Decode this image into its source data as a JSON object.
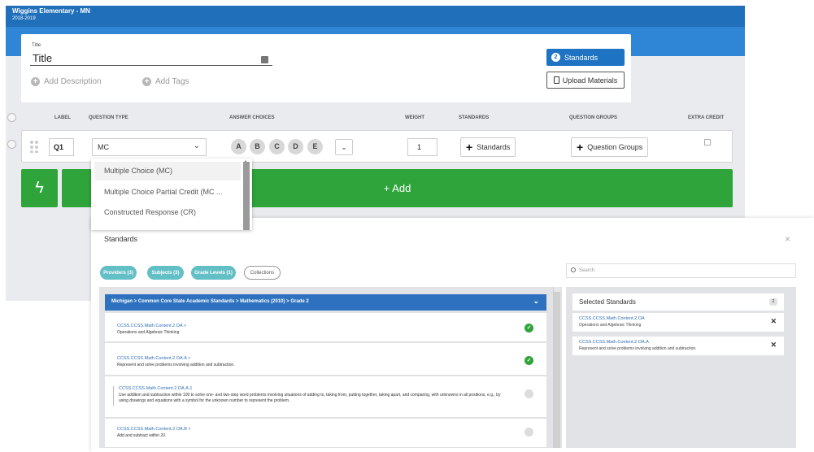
{
  "header": {
    "school": "Wiggins Elementary - MN",
    "year": "2018-2019"
  },
  "form": {
    "title_label": "Title",
    "title_value": "Title",
    "add_description": "Add Description",
    "add_tags": "Add Tags",
    "standards_count": "2",
    "standards_button": "Standards",
    "upload_button": "Upload Materials"
  },
  "columns": {
    "label": "LABEL",
    "question_type": "QUESTION TYPE",
    "answer_choices": "ANSWER CHOICES",
    "weight": "WEIGHT",
    "standards": "STANDARDS",
    "question_groups": "QUESTION GROUPS",
    "extra_credit": "EXTRA CREDIT"
  },
  "question": {
    "label": "Q1",
    "type": "MC",
    "choices": [
      "A",
      "B",
      "C",
      "D",
      "E"
    ],
    "weight": "1",
    "standards_button": "Standards",
    "groups_button": "Question Groups"
  },
  "type_options": [
    "Multiple Choice (MC)",
    "Multiple Choice Partial Credit (MC ...",
    "Constructed Response (CR)"
  ],
  "add_button": "+ Add",
  "modal": {
    "title": "Standards",
    "filters": [
      "Providers (3)",
      "Subjects (3)",
      "Grade Levels (1)",
      "Collections"
    ],
    "search_placeholder": "Search",
    "breadcrumb": "Michigan  >  Common Core State Academic Standards  >  Mathematics (2010)  >  Grade 2",
    "list": [
      {
        "code": "CCSS.CCSS.Math.Content.2.OA  >",
        "desc": "Operations and Algebraic Thinking",
        "selected": true
      },
      {
        "code": "CCSS.CCSS.Math.Content.2.OA.A  >",
        "desc": "Represent and solve problems involving addition and subtraction.",
        "selected": true
      },
      {
        "code": "CCSS.CCSS.Math.Content.2.OA.A.1",
        "desc": "Use addition and subtraction within 100 to solve one- and two-step word problems involving situations of adding to, taking from, putting together, taking apart, and comparing, with unknowns in all positions, e.g., by using drawings and equations with a symbol for the unknown number to represent the problem.",
        "selected": false
      },
      {
        "code": "CCSS.CCSS.Math.Content.2.OA.B  >",
        "desc": "Add and subtract within 20.",
        "selected": false
      }
    ],
    "selected_title": "Selected Standards",
    "selected_count": "2",
    "selected": [
      {
        "code": "CCSS.CCSS.Math.Content.2.OA",
        "desc": "Operations and Algebraic Thinking"
      },
      {
        "code": "CCSS.CCSS.Math.Content.2.OA.A",
        "desc": "Represent and solve problems involving addition and subtraction."
      }
    ]
  }
}
